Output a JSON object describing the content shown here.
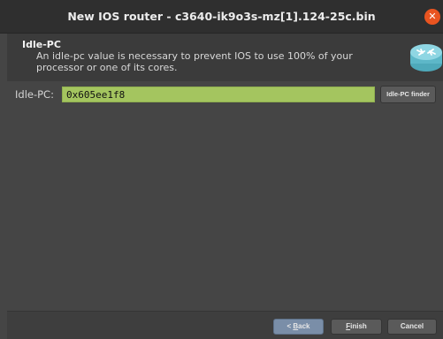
{
  "window": {
    "title": "New IOS router - c3640-ik9o3s-mz[1].124-25c.bin",
    "close_icon": "close-icon"
  },
  "header": {
    "title": "Idle-PC",
    "description": "An idle-pc value is necessary to prevent IOS to use 100% of your processor or one of its cores.",
    "icon": "router-icon"
  },
  "form": {
    "idle_pc_label": "Idle-PC:",
    "idle_pc_value": "0x605ee1f8",
    "finder_button_label": "Idle-PC finder"
  },
  "footer": {
    "back_label_prefix": "< ",
    "back_label_mnemonic": "B",
    "back_label_rest": "ack",
    "finish_label_mnemonic": "F",
    "finish_label_rest": "inish",
    "cancel_label": "Cancel"
  },
  "colors": {
    "accent_input": "#a4c55f",
    "close_button": "#e95420",
    "default_button": "#7a8ea8",
    "router_icon": "#6ec3d3"
  }
}
